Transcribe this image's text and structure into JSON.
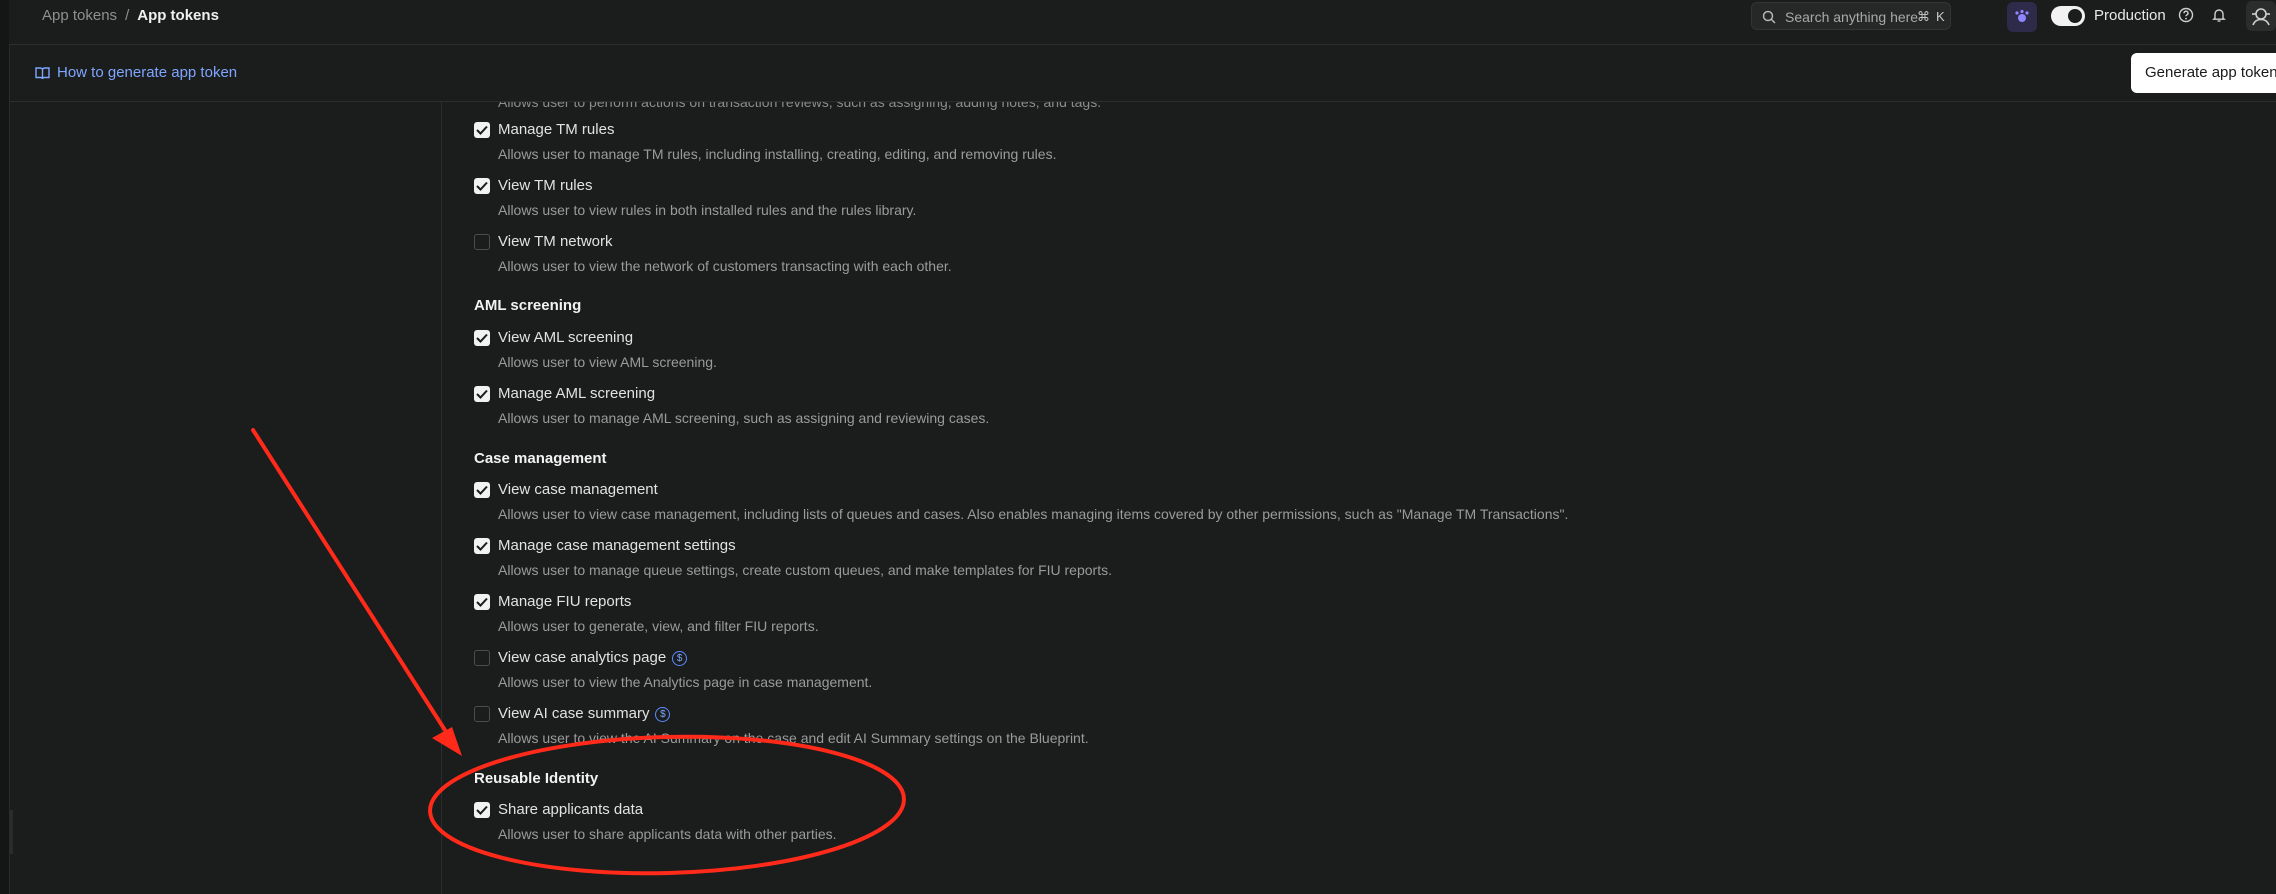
{
  "breadcrumb": {
    "parent": "App tokens",
    "separator": "/",
    "current": "App tokens"
  },
  "search": {
    "placeholder": "Search anything here",
    "shortcut_mod": "⌘",
    "shortcut_key": "K"
  },
  "environment": {
    "label": "Production",
    "enabled": true
  },
  "subheader": {
    "help_link": "How to generate app token",
    "generate_button": "Generate app token"
  },
  "clipped_text": "Allows user to perform actions on transaction reviews, such as assigning, adding notes, and tags.",
  "sections": [
    {
      "title": "",
      "permissions": [
        {
          "label": "Manage TM rules",
          "desc": "Allows user to manage TM rules, including installing, creating, editing, and removing rules.",
          "checked": true,
          "paid": false
        },
        {
          "label": "View TM rules",
          "desc": "Allows user to view rules in both installed rules and the rules library.",
          "checked": true,
          "paid": false
        },
        {
          "label": "View TM network",
          "desc": "Allows user to view the network of customers transacting with each other.",
          "checked": false,
          "paid": false
        }
      ]
    },
    {
      "title": "AML screening",
      "permissions": [
        {
          "label": "View AML screening",
          "desc": "Allows user to view AML screening.",
          "checked": true,
          "paid": false
        },
        {
          "label": "Manage AML screening",
          "desc": "Allows user to manage AML screening, such as assigning and reviewing cases.",
          "checked": true,
          "paid": false
        }
      ]
    },
    {
      "title": "Case management",
      "permissions": [
        {
          "label": "View case management",
          "desc": "Allows user to view case management, including lists of queues and cases. Also enables managing items covered by other permissions, such as \"Manage TM Transactions\".",
          "checked": true,
          "paid": false
        },
        {
          "label": "Manage case management settings",
          "desc": "Allows user to manage queue settings, create custom queues, and make templates for FIU reports.",
          "checked": true,
          "paid": false
        },
        {
          "label": "Manage FIU reports",
          "desc": "Allows user to generate, view, and filter FIU reports.",
          "checked": true,
          "paid": false
        },
        {
          "label": "View case analytics page",
          "desc": "Allows user to view the Analytics page in case management.",
          "checked": false,
          "paid": true
        },
        {
          "label": "View AI case summary",
          "desc": "Allows user to view the AI Summary on the case and edit AI Summary settings on the Blueprint.",
          "checked": false,
          "paid": true
        }
      ]
    },
    {
      "title": "Reusable Identity",
      "permissions": [
        {
          "label": "Share applicants data",
          "desc": "Allows user to share applicants data with other parties.",
          "checked": true,
          "paid": false
        }
      ]
    }
  ],
  "paid_badge": "$",
  "colors": {
    "background": "#1b1c1c",
    "link": "#7ea6ff",
    "annotation": "#ff2a1a"
  }
}
